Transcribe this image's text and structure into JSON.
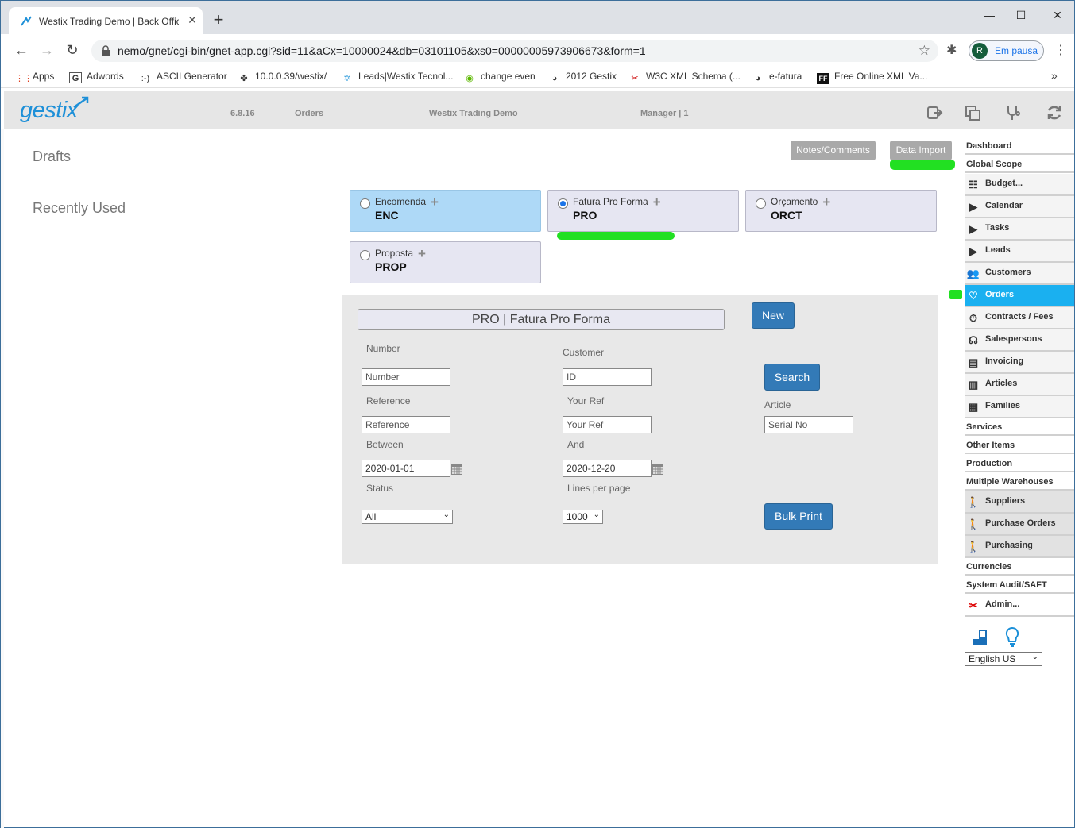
{
  "browser": {
    "tab_title": "Westix Trading Demo | Back Offic",
    "url": "nemo/gnet/cgi-bin/gnet-app.cgi?sid=11&aCx=10000024&db=03101105&xs0=00000005973906673&form=1",
    "profile_initial": "R",
    "profile_label": "Em pausa",
    "bookmarks": [
      {
        "label": "Apps",
        "icon": "apps-grid-icon"
      },
      {
        "label": "Adwords",
        "icon": "google-icon"
      },
      {
        "label": "ASCII Generator",
        "icon": "ascii-icon"
      },
      {
        "label": "10.0.0.39/westix/",
        "icon": "fan-icon"
      },
      {
        "label": "Leads|Westix Tecnol...",
        "icon": "sparkle-icon"
      },
      {
        "label": "change even",
        "icon": "green-icon"
      },
      {
        "label": "2012 Gestix",
        "icon": "globe-icon"
      },
      {
        "label": "W3C XML Schema (...",
        "icon": "w3c-icon"
      },
      {
        "label": "e-fatura",
        "icon": "globe-icon"
      },
      {
        "label": "Free Online XML Va...",
        "icon": "ff-icon"
      }
    ]
  },
  "app": {
    "logo": "gestix",
    "version": "6.8.16",
    "module": "Orders",
    "company": "Westix Trading Demo",
    "user": "Manager | 1"
  },
  "left": {
    "drafts": "Drafts",
    "recently_used": "Recently Used"
  },
  "top_buttons": {
    "notes": "Notes/Comments",
    "data_import": "Data Import"
  },
  "doc_types": [
    {
      "name": "Encomenda",
      "code": "ENC",
      "selected": false
    },
    {
      "name": "Fatura Pro Forma",
      "code": "PRO",
      "selected": true
    },
    {
      "name": "Orçamento",
      "code": "ORCT",
      "selected": false
    },
    {
      "name": "Proposta",
      "code": "PROP",
      "selected": false
    }
  ],
  "search": {
    "title": "PRO | Fatura Pro Forma",
    "new_label": "New",
    "search_label": "Search",
    "bulk_print_label": "Bulk Print",
    "number_label": "Number",
    "number_placeholder": "Number",
    "customer_label": "Customer",
    "customer_placeholder": "ID",
    "reference_label": "Reference",
    "reference_placeholder": "Reference",
    "yourref_label": "Your Ref",
    "yourref_placeholder": "Your Ref",
    "article_label": "Article",
    "serial_placeholder": "Serial No",
    "between_label": "Between",
    "between_value": "2020-01-01",
    "and_label": "And",
    "and_value": "2020-12-20",
    "status_label": "Status",
    "status_value": "All",
    "lines_label": "Lines per page",
    "lines_value": "1000"
  },
  "sidebar": {
    "items": [
      {
        "label": "Dashboard"
      },
      {
        "label": "Global Scope"
      },
      {
        "label": "Budget..."
      },
      {
        "label": "Calendar"
      },
      {
        "label": "Tasks"
      },
      {
        "label": "Leads"
      },
      {
        "label": "Customers"
      },
      {
        "label": "Orders"
      },
      {
        "label": "Contracts / Fees"
      },
      {
        "label": "Salespersons"
      },
      {
        "label": "Invoicing"
      },
      {
        "label": "Articles"
      },
      {
        "label": "Families"
      },
      {
        "label": "Services"
      },
      {
        "label": "Other Items"
      },
      {
        "label": "Production"
      },
      {
        "label": "Multiple Warehouses"
      },
      {
        "label": "Suppliers"
      },
      {
        "label": "Purchase Orders"
      },
      {
        "label": "Purchasing"
      },
      {
        "label": "Currencies"
      },
      {
        "label": "System Audit/SAFT"
      },
      {
        "label": "Admin..."
      }
    ],
    "language": "English US"
  },
  "colors": {
    "accent": "#1ab0f0",
    "button": "#337ab7",
    "highlight": "#22e022"
  }
}
